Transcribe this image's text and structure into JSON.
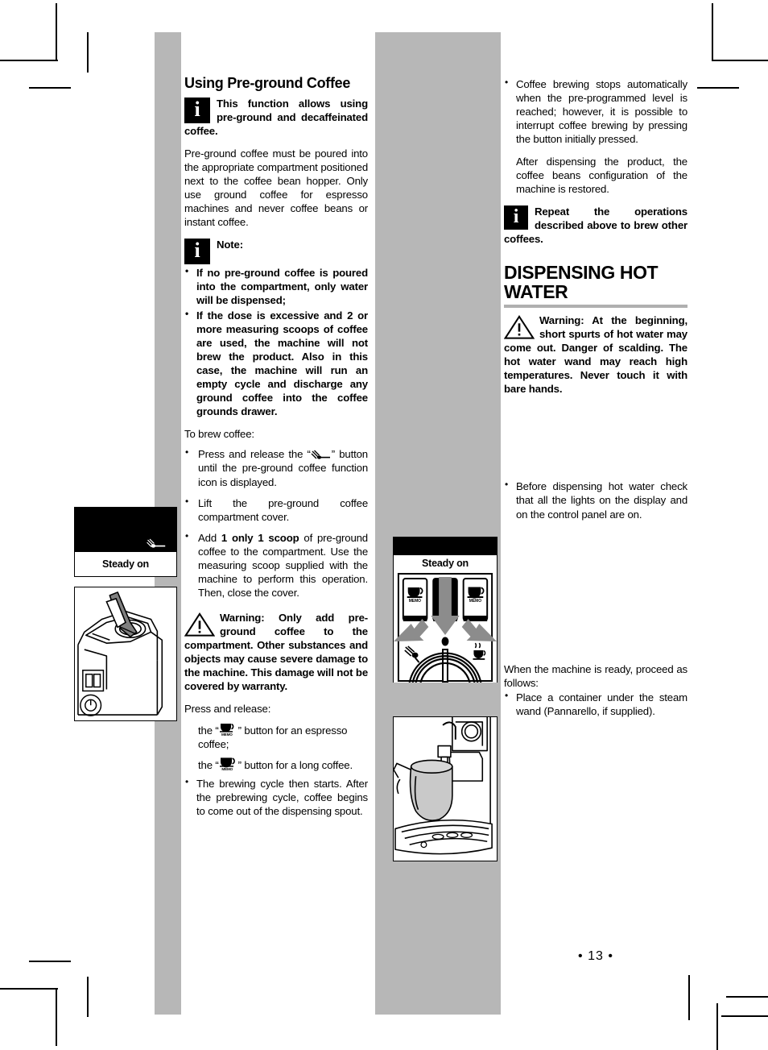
{
  "page": {
    "number": "• 13 •"
  },
  "left_column": {
    "heading": "Using Pre-ground Coffee",
    "info_callout_1": "This function allows using pre-ground and decaffeinated coffee.",
    "para_1": "Pre-ground coffee must be poured into the appropriate compartment positioned next to the coffee bean hopper. Only use ground coffee for espresso machines and never coffee beans or instant coffee.",
    "note_label": "Note:",
    "note_items": [
      "If no pre-ground coffee is poured into the compartment, only water will be dispensed;",
      "If the dose is excessive and 2 or more measuring scoops of coffee are used, the machine will not brew the product. Also in this case, the machine will run an empty cycle and discharge any ground coffee into the coffee grounds drawer."
    ],
    "brew_intro": "To brew coffee:",
    "brew_steps": [
      {
        "before": "Press and release the “",
        "icon": "pre-ground-coffee-button-icon",
        "after": "” button until the pre-ground coffee function icon is displayed."
      },
      {
        "text": "Lift the pre-ground coffee compartment cover."
      },
      {
        "before": "Add ",
        "strong": "1 only 1 scoop",
        "after": " of pre-ground coffee to the compartment. Use the measuring scoop supplied with the machine to perform this operation. Then, close the cover."
      }
    ],
    "warning_callout": "Warning: Only add pre-ground coffee to the compartment. Other substances and objects may cause severe damage to the machine. This damage will not be covered by warranty.",
    "press_release_intro": "Press and release:",
    "press_release_lines": [
      {
        "before": "the “",
        "icon": "espresso-memo-button-icon",
        "after": "” button for an espresso coffee;"
      },
      {
        "before": "the “",
        "icon": "long-coffee-memo-button-icon",
        "after": "” button for a long coffee."
      }
    ],
    "final_bullet": "The brewing cycle then starts. After the prebrewing cycle, coffee begins to come out of the dispensing spout."
  },
  "right_column": {
    "bullet_1": "Coffee brewing stops automatically when the pre-programmed level is reached; however, it is possible to interrupt coffee brewing by pressing the button initially pressed.",
    "para_1": "After dispensing the product, the coffee beans configuration of the machine is restored.",
    "info_callout_1": "Repeat the operations described above to brew other coffees.",
    "section_heading_line1": "DISPENSING HOT",
    "section_heading_line2": "WATER",
    "warning_callout": "Warning: At the beginning, short spurts of hot water may come out. Danger of scalding. The hot water wand may reach high temperatures. Never touch it with bare hands.",
    "bullet_2": "Before dispensing hot water check that all the lights on the display and on the control panel are on.",
    "ready_intro_line1": "When the machine is ready, proceed as",
    "ready_intro_line2": "follows:",
    "ready_bullet": "Place a container under the steam wand (Pannarello, if supplied)."
  },
  "figures": {
    "display_left": {
      "name": "pre-ground-coffee-display",
      "icon": "pre-ground-coffee-icon",
      "label": "Steady on"
    },
    "machine_left": {
      "name": "pre-ground-compartment-scoop-illustration"
    },
    "display_mid": {
      "name": "coffee-beans-display",
      "icon": "coffee-beans-icon",
      "label": "Steady on"
    },
    "panel_mid": {
      "name": "control-panel-illustration",
      "label": "Steady on",
      "button_left_text": "MEMO",
      "button_right_text": "MEMO",
      "knob_left_icon": "steam-icon",
      "knob_right_icon": "hot-water-cup-icon"
    },
    "jug_mid": {
      "name": "container-under-steam-wand-illustration"
    }
  },
  "colors": {
    "band_gray": "#b7b7b7",
    "rule_gray": "#b0b0b0",
    "ink": "#000000",
    "paper": "#ffffff"
  }
}
